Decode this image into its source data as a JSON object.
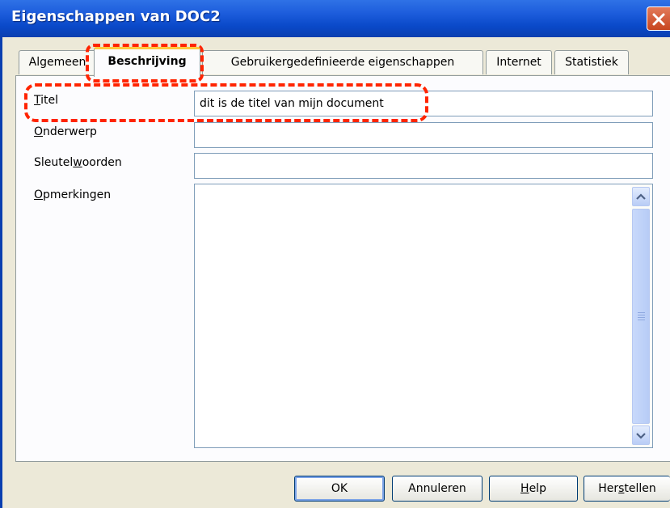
{
  "window": {
    "title": "Eigenschappen van DOC2"
  },
  "tabs": [
    {
      "label": "Algemeen"
    },
    {
      "label": "Beschrijving",
      "active": true
    },
    {
      "label": "Gebruikergedefinieerde eigenschappen"
    },
    {
      "label": "Internet"
    },
    {
      "label": "Statistiek"
    }
  ],
  "fields": {
    "titel": {
      "label_first": "T",
      "label_rest": "itel",
      "value": "dit is de titel van mijn document"
    },
    "onderwerp": {
      "label_first": "O",
      "label_rest": "nderwerp",
      "value": ""
    },
    "sleutelwoorden": {
      "label_pre": "Sleutel",
      "label_u": "w",
      "label_post": "oorden",
      "value": ""
    },
    "opmerkingen": {
      "label_first": "O",
      "label_rest": "pmerkingen",
      "value": ""
    }
  },
  "buttons": {
    "ok": "OK",
    "cancel": "Annuleren",
    "help_u": "H",
    "help_rest": "elp",
    "reset_pre": "Her",
    "reset_u": "s",
    "reset_post": "tellen"
  },
  "colors": {
    "annotation": "#ff2400",
    "titlebar": "#0a49c9",
    "active_tab_accent": "#ffc83c"
  },
  "icons": {
    "close": "close-icon",
    "scroll_up": "chevron-up-icon",
    "scroll_down": "chevron-down-icon"
  }
}
